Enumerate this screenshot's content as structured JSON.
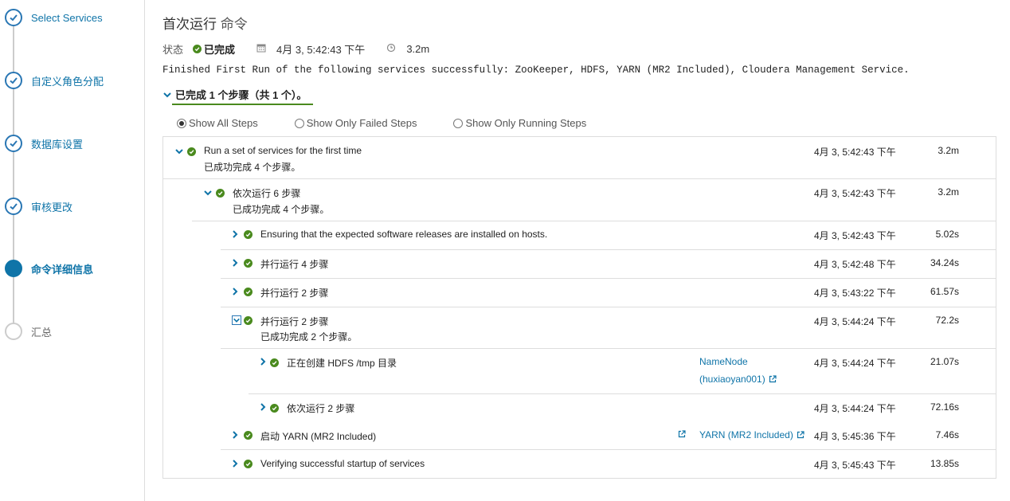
{
  "sidebar": {
    "steps": [
      {
        "label": "Select Services",
        "state": "done"
      },
      {
        "label": "自定义角色分配",
        "state": "done"
      },
      {
        "label": "数据库设置",
        "state": "done"
      },
      {
        "label": "审核更改",
        "state": "done"
      },
      {
        "label": "命令详细信息",
        "state": "current"
      },
      {
        "label": "汇总",
        "state": "future"
      }
    ]
  },
  "header": {
    "title": "首次运行",
    "subtitle": "命令",
    "status_label": "状态",
    "status_value": "已完成",
    "date": "4月 3, 5:42:43 下午",
    "duration": "3.2m",
    "summary": "Finished First Run of the following services successfully: ZooKeeper, HDFS, YARN (MR2 Included), Cloudera Management Service."
  },
  "progress": {
    "label": "已完成 1 个步骤（共 1 个）。"
  },
  "filters": {
    "all": "Show All Steps",
    "failed": "Show Only Failed Steps",
    "running": "Show Only Running Steps"
  },
  "rows": [
    {
      "name": "Run a set of services for the first time",
      "sub": "已成功完成  4  个步骤。",
      "date": "4月 3, 5:42:43 下午",
      "dur": "3.2m"
    },
    {
      "name": "依次运行 6 步骤",
      "sub": "已成功完成  4  个步骤。",
      "date": "4月 3, 5:42:43 下午",
      "dur": "3.2m"
    },
    {
      "name": "Ensuring that the expected software releases are installed on hosts.",
      "date": "4月 3, 5:42:43 下午",
      "dur": "5.02s"
    },
    {
      "name": "并行运行 4 步骤",
      "date": "4月 3, 5:42:48 下午",
      "dur": "34.24s"
    },
    {
      "name": "并行运行 2 步骤",
      "date": "4月 3, 5:43:22 下午",
      "dur": "61.57s"
    },
    {
      "name": "并行运行 2 步骤",
      "sub": "已成功完成  2  个步骤。",
      "date": "4月 3, 5:44:24 下午",
      "dur": "72.2s"
    },
    {
      "name": "正在创建 HDFS /tmp 目录",
      "link1": "NameNode",
      "link2": "(huxiaoyan001)",
      "date": "4月 3, 5:44:24 下午",
      "dur": "21.07s"
    },
    {
      "name": "依次运行 2 步骤",
      "date": "4月 3, 5:44:24 下午",
      "dur": "72.16s"
    },
    {
      "name": "启动 YARN (MR2 Included)",
      "link1": "YARN (MR2 Included)",
      "date": "4月 3, 5:45:36 下午",
      "dur": "7.46s"
    },
    {
      "name": "Verifying successful startup of services",
      "date": "4月 3, 5:45:43 下午",
      "dur": "13.85s"
    }
  ],
  "icons": {
    "check": "check-icon",
    "calendar": "calendar-icon",
    "clock": "clock-icon",
    "chevron_right": "chevron-right-icon",
    "chevron_down": "chevron-down-icon",
    "external_link": "external-link-icon"
  },
  "colors": {
    "accent": "#0f74a8",
    "success": "#4a8a1e",
    "border": "#dddddd"
  }
}
